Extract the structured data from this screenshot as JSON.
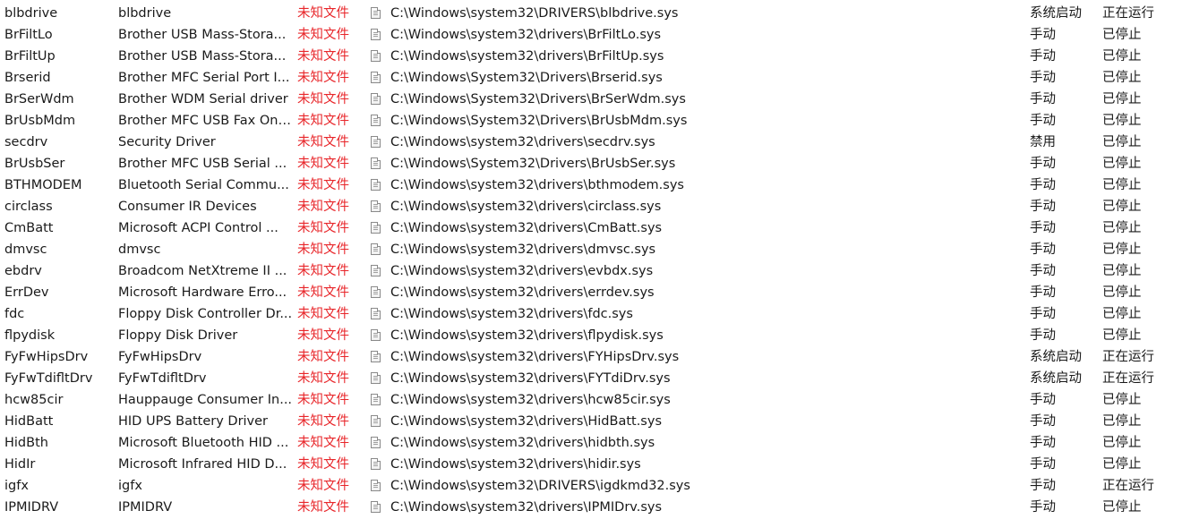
{
  "colors": {
    "text": "#1a1a1a",
    "signature_warning": "#e8262a",
    "background": "#ffffff"
  },
  "drivers": [
    {
      "name": "blbdrive",
      "description": "blbdrive",
      "signature": "未知文件",
      "icon": "file-icon",
      "path": "C:\\Windows\\system32\\DRIVERS\\blbdrive.sys",
      "startup": "系统启动",
      "state": "正在运行"
    },
    {
      "name": "BrFiltLo",
      "description": "Brother USB Mass-Stora...",
      "signature": "未知文件",
      "icon": "file-icon",
      "path": "C:\\Windows\\system32\\drivers\\BrFiltLo.sys",
      "startup": "手动",
      "state": "已停止"
    },
    {
      "name": "BrFiltUp",
      "description": "Brother USB Mass-Stora...",
      "signature": "未知文件",
      "icon": "file-icon",
      "path": "C:\\Windows\\system32\\drivers\\BrFiltUp.sys",
      "startup": "手动",
      "state": "已停止"
    },
    {
      "name": "Brserid",
      "description": "Brother MFC Serial Port I...",
      "signature": "未知文件",
      "icon": "file-icon",
      "path": "C:\\Windows\\System32\\Drivers\\Brserid.sys",
      "startup": "手动",
      "state": "已停止"
    },
    {
      "name": "BrSerWdm",
      "description": "Brother WDM Serial driver",
      "signature": "未知文件",
      "icon": "file-icon",
      "path": "C:\\Windows\\System32\\Drivers\\BrSerWdm.sys",
      "startup": "手动",
      "state": "已停止"
    },
    {
      "name": "BrUsbMdm",
      "description": "Brother MFC USB Fax Onl...",
      "signature": "未知文件",
      "icon": "file-icon",
      "path": "C:\\Windows\\System32\\Drivers\\BrUsbMdm.sys",
      "startup": "手动",
      "state": "已停止"
    },
    {
      "name": "secdrv",
      "description": "Security Driver",
      "signature": "未知文件",
      "icon": "file-icon",
      "path": "C:\\Windows\\system32\\drivers\\secdrv.sys",
      "startup": "禁用",
      "state": "已停止"
    },
    {
      "name": "BrUsbSer",
      "description": "Brother MFC USB Serial ...",
      "signature": "未知文件",
      "icon": "file-icon",
      "path": "C:\\Windows\\System32\\Drivers\\BrUsbSer.sys",
      "startup": "手动",
      "state": "已停止"
    },
    {
      "name": "BTHMODEM",
      "description": "Bluetooth Serial Commu...",
      "signature": "未知文件",
      "icon": "file-icon",
      "path": "C:\\Windows\\system32\\drivers\\bthmodem.sys",
      "startup": "手动",
      "state": "已停止"
    },
    {
      "name": "circlass",
      "description": "Consumer IR Devices",
      "signature": "未知文件",
      "icon": "file-icon",
      "path": "C:\\Windows\\system32\\drivers\\circlass.sys",
      "startup": "手动",
      "state": "已停止"
    },
    {
      "name": "CmBatt",
      "description": "Microsoft ACPI Control ...",
      "signature": "未知文件",
      "icon": "file-icon",
      "path": "C:\\Windows\\system32\\drivers\\CmBatt.sys",
      "startup": "手动",
      "state": "已停止"
    },
    {
      "name": "dmvsc",
      "description": "dmvsc",
      "signature": "未知文件",
      "icon": "file-icon",
      "path": "C:\\Windows\\system32\\drivers\\dmvsc.sys",
      "startup": "手动",
      "state": "已停止"
    },
    {
      "name": "ebdrv",
      "description": "Broadcom NetXtreme II ...",
      "signature": "未知文件",
      "icon": "file-icon",
      "path": "C:\\Windows\\system32\\drivers\\evbdx.sys",
      "startup": "手动",
      "state": "已停止"
    },
    {
      "name": "ErrDev",
      "description": "Microsoft Hardware Erro...",
      "signature": "未知文件",
      "icon": "file-icon",
      "path": "C:\\Windows\\system32\\drivers\\errdev.sys",
      "startup": "手动",
      "state": "已停止"
    },
    {
      "name": "fdc",
      "description": "Floppy Disk Controller Dr...",
      "signature": "未知文件",
      "icon": "file-icon",
      "path": "C:\\Windows\\system32\\drivers\\fdc.sys",
      "startup": "手动",
      "state": "已停止"
    },
    {
      "name": "flpydisk",
      "description": "Floppy Disk Driver",
      "signature": "未知文件",
      "icon": "file-icon",
      "path": "C:\\Windows\\system32\\drivers\\flpydisk.sys",
      "startup": "手动",
      "state": "已停止"
    },
    {
      "name": "FyFwHipsDrv",
      "description": "FyFwHipsDrv",
      "signature": "未知文件",
      "icon": "file-icon",
      "path": "C:\\Windows\\system32\\drivers\\FYHipsDrv.sys",
      "startup": "系统启动",
      "state": "正在运行"
    },
    {
      "name": "FyFwTdifltDrv",
      "description": "FyFwTdifltDrv",
      "signature": "未知文件",
      "icon": "file-icon",
      "path": "C:\\Windows\\system32\\drivers\\FYTdiDrv.sys",
      "startup": "系统启动",
      "state": "正在运行"
    },
    {
      "name": "hcw85cir",
      "description": "Hauppauge Consumer In...",
      "signature": "未知文件",
      "icon": "file-icon",
      "path": "C:\\Windows\\system32\\drivers\\hcw85cir.sys",
      "startup": "手动",
      "state": "已停止"
    },
    {
      "name": "HidBatt",
      "description": "HID UPS Battery Driver",
      "signature": "未知文件",
      "icon": "file-icon",
      "path": "C:\\Windows\\system32\\drivers\\HidBatt.sys",
      "startup": "手动",
      "state": "已停止"
    },
    {
      "name": "HidBth",
      "description": "Microsoft Bluetooth HID ...",
      "signature": "未知文件",
      "icon": "file-icon",
      "path": "C:\\Windows\\system32\\drivers\\hidbth.sys",
      "startup": "手动",
      "state": "已停止"
    },
    {
      "name": "HidIr",
      "description": "Microsoft Infrared HID D...",
      "signature": "未知文件",
      "icon": "file-icon",
      "path": "C:\\Windows\\system32\\drivers\\hidir.sys",
      "startup": "手动",
      "state": "已停止"
    },
    {
      "name": "igfx",
      "description": "igfx",
      "signature": "未知文件",
      "icon": "file-icon",
      "path": "C:\\Windows\\system32\\DRIVERS\\igdkmd32.sys",
      "startup": "手动",
      "state": "正在运行"
    },
    {
      "name": "IPMIDRV",
      "description": "IPMIDRV",
      "signature": "未知文件",
      "icon": "file-icon",
      "path": "C:\\Windows\\system32\\drivers\\IPMIDrv.sys",
      "startup": "手动",
      "state": "已停止"
    }
  ]
}
